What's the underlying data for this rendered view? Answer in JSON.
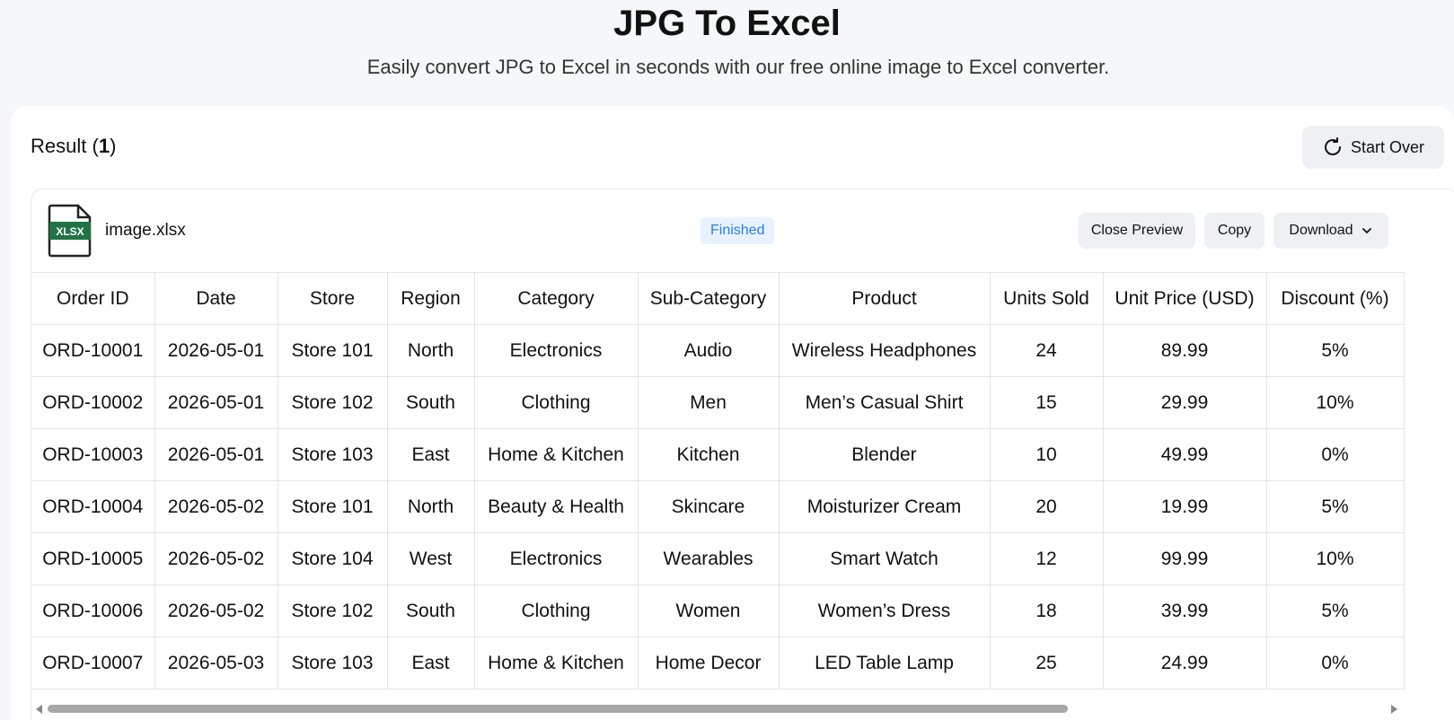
{
  "page": {
    "title": "JPG To Excel",
    "subtitle": "Easily convert JPG to Excel in seconds with our free online image to Excel converter."
  },
  "result": {
    "label": "Result",
    "count": "1",
    "start_over_label": "Start Over"
  },
  "file": {
    "icon_label": "XLSX",
    "name": "image.xlsx",
    "status": "Finished",
    "close_preview_label": "Close Preview",
    "copy_label": "Copy",
    "download_label": "Download"
  },
  "table": {
    "columns": [
      "Order ID",
      "Date",
      "Store",
      "Region",
      "Category",
      "Sub-Category",
      "Product",
      "Units Sold",
      "Unit Price (USD)",
      "Discount (%)"
    ],
    "rows": [
      [
        "ORD-10001",
        "2026-05-01",
        "Store 101",
        "North",
        "Electronics",
        "Audio",
        "Wireless Headphones",
        "24",
        "89.99",
        "5%"
      ],
      [
        "ORD-10002",
        "2026-05-01",
        "Store 102",
        "South",
        "Clothing",
        "Men",
        "Men’s Casual Shirt",
        "15",
        "29.99",
        "10%"
      ],
      [
        "ORD-10003",
        "2026-05-01",
        "Store 103",
        "East",
        "Home & Kitchen",
        "Kitchen",
        "Blender",
        "10",
        "49.99",
        "0%"
      ],
      [
        "ORD-10004",
        "2026-05-02",
        "Store 101",
        "North",
        "Beauty & Health",
        "Skincare",
        "Moisturizer Cream",
        "20",
        "19.99",
        "5%"
      ],
      [
        "ORD-10005",
        "2026-05-02",
        "Store 104",
        "West",
        "Electronics",
        "Wearables",
        "Smart Watch",
        "12",
        "99.99",
        "10%"
      ],
      [
        "ORD-10006",
        "2026-05-02",
        "Store 102",
        "South",
        "Clothing",
        "Women",
        "Women’s Dress",
        "18",
        "39.99",
        "5%"
      ],
      [
        "ORD-10007",
        "2026-05-03",
        "Store 103",
        "East",
        "Home & Kitchen",
        "Home Decor",
        "LED Table Lamp",
        "25",
        "24.99",
        "0%"
      ]
    ]
  },
  "colors": {
    "page_bg": "#f5f7fa",
    "badge_text": "#2b7de9",
    "badge_bg": "#e8f2fe",
    "xlsx_green": "#217346"
  },
  "icons": {
    "start_over": "refresh-icon",
    "file": "xlsx-file-icon",
    "download": "chevron-down-icon"
  }
}
